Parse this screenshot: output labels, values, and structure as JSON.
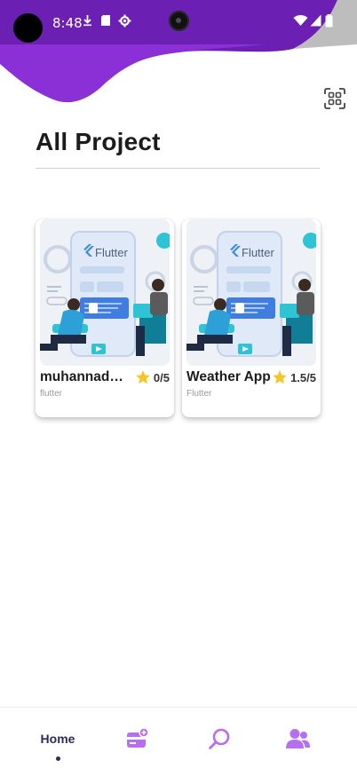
{
  "status_bar": {
    "time": "8:48",
    "left_icons": [
      "download-icon",
      "sd-card-icon",
      "settings-icon"
    ],
    "right_icons": [
      "wifi-icon",
      "signal-icon",
      "battery-icon"
    ]
  },
  "colors": {
    "header_purple": "#6c1fb3",
    "header_purple_light": "#8b2fd6",
    "nav_inactive": "#b56ff0",
    "nav_active": "#2c2c5c",
    "star": "#f6c625"
  },
  "header": {
    "scan_icon": "scan-icon"
  },
  "page": {
    "title": "All Project"
  },
  "projects": [
    {
      "name": "muhannad alsaed",
      "rating": "0/5",
      "tag": "flutter",
      "image_icon": "flutter-illustration"
    },
    {
      "name": "Weather App",
      "rating": "1.5/5",
      "tag": "Flutter",
      "image_icon": "flutter-illustration"
    }
  ],
  "bottom_nav": {
    "items": [
      {
        "label": "Home",
        "active": true
      },
      {
        "icon": "add-card-icon"
      },
      {
        "icon": "search-icon"
      },
      {
        "icon": "users-icon"
      }
    ]
  }
}
